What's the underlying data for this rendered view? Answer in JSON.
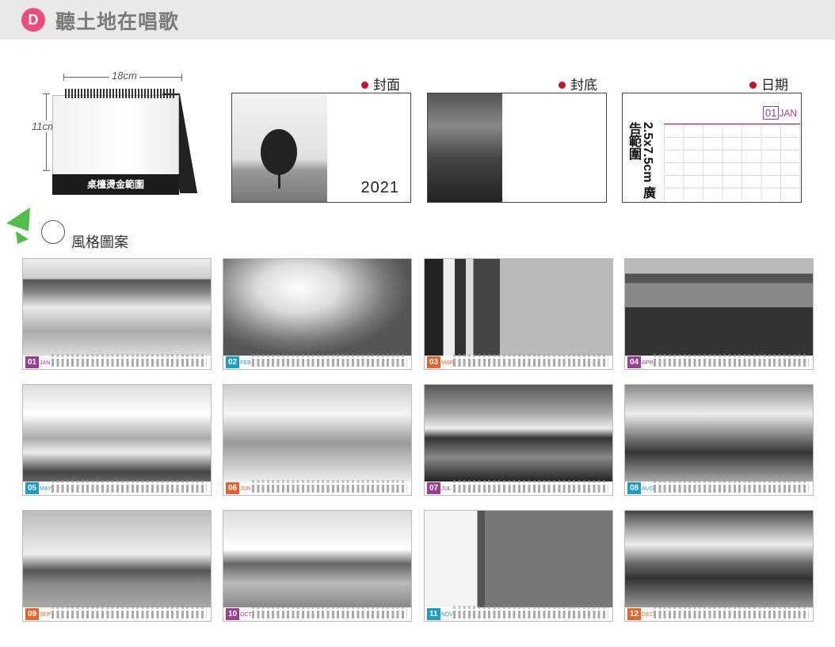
{
  "header": {
    "badge": "D",
    "title": "聽土地在唱歌"
  },
  "product": {
    "width_label": "18cm",
    "height_label": "11cm",
    "base_text": "桌檯燙金範圍"
  },
  "previews": {
    "cover_label": "封面",
    "back_label": "封底",
    "date_label": "日期",
    "cover_year": "2021",
    "ad_text": "2.5x7.5cm 廣告範圍",
    "mini_month_num": "01",
    "mini_month_name": "JAN"
  },
  "style_section": {
    "label": "風格圖案"
  },
  "months": [
    {
      "num": "01",
      "name": "JAN",
      "color": "#9b3d91"
    },
    {
      "num": "02",
      "name": "FEB",
      "color": "#1a9bc8"
    },
    {
      "num": "03",
      "name": "MAR",
      "color": "#e8632b"
    },
    {
      "num": "04",
      "name": "APR",
      "color": "#9b3d91"
    },
    {
      "num": "05",
      "name": "MAY",
      "color": "#1a9bc8"
    },
    {
      "num": "06",
      "name": "JUN",
      "color": "#e8632b"
    },
    {
      "num": "07",
      "name": "JUL",
      "color": "#9b3d91"
    },
    {
      "num": "08",
      "name": "AUG",
      "color": "#1a9bc8"
    },
    {
      "num": "09",
      "name": "SEP",
      "color": "#e8632b"
    },
    {
      "num": "10",
      "name": "OCT",
      "color": "#9b3d91"
    },
    {
      "num": "11",
      "name": "NOV",
      "color": "#1a9bc8"
    },
    {
      "num": "12",
      "name": "DEC",
      "color": "#e8632b"
    }
  ]
}
